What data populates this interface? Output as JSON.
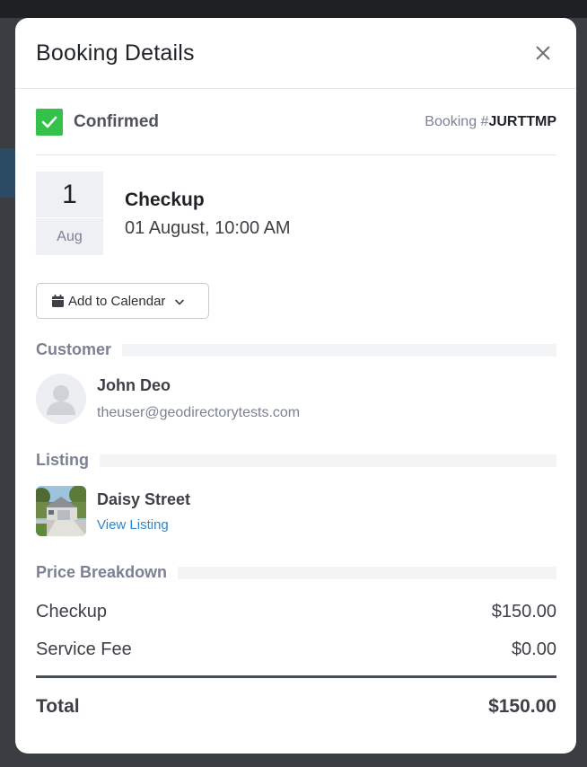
{
  "modal": {
    "title": "Booking Details",
    "close_icon": "close-icon"
  },
  "status": {
    "label": "Confirmed",
    "icon": "checkmark-icon",
    "color": "#35c24a",
    "booking_prefix": "Booking #",
    "booking_code": "JURTTMP"
  },
  "event": {
    "day": "1",
    "month": "Aug",
    "title": "Checkup",
    "datetime": "01 August, 10:00 AM"
  },
  "calendar_button": {
    "label": "Add to Calendar",
    "icon": "calendar-icon",
    "caret_icon": "chevron-down-icon"
  },
  "customer": {
    "section_label": "Customer",
    "name": "John Deo",
    "email": "theuser@geodirectorytests.com",
    "avatar_icon": "user-avatar-icon"
  },
  "listing": {
    "section_label": "Listing",
    "name": "Daisy Street",
    "link_label": "View Listing",
    "link_color": "#2a87d1"
  },
  "price": {
    "section_label": "Price Breakdown",
    "items": [
      {
        "label": "Checkup",
        "amount": "$150.00"
      },
      {
        "label": "Service Fee",
        "amount": "$0.00"
      }
    ],
    "total_label": "Total",
    "total_amount": "$150.00"
  }
}
